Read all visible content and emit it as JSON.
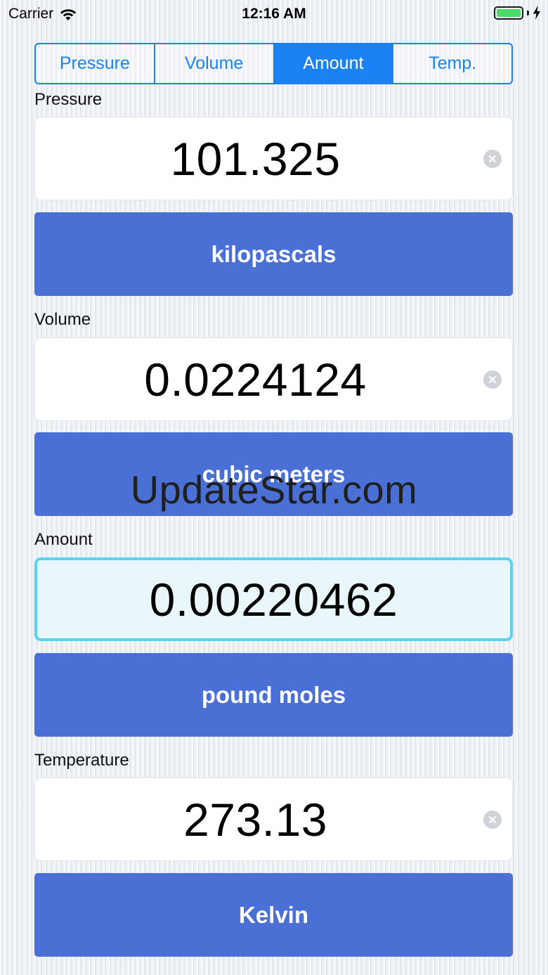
{
  "status_bar": {
    "carrier": "Carrier",
    "time": "12:16 AM",
    "battery_color": "#4cd964"
  },
  "tabs": {
    "items": [
      {
        "label": "Pressure"
      },
      {
        "label": "Volume"
      },
      {
        "label": "Amount"
      },
      {
        "label": "Temp."
      }
    ],
    "selected": "Amount",
    "accent_color": "#1a82f5"
  },
  "fields": {
    "pressure": {
      "label": "Pressure",
      "value": "101.325",
      "unit": "kilopascals"
    },
    "volume": {
      "label": "Volume",
      "value": "0.0224124",
      "unit": "cubic meters"
    },
    "amount": {
      "label": "Amount",
      "value": "0.00220462",
      "unit": "pound moles"
    },
    "temperature": {
      "label": "Temperature",
      "value": "273.13",
      "unit": "Kelvin"
    }
  },
  "unit_button_color": "#4a6fd5",
  "watermark": "UpdateStar.com",
  "icons": {
    "wifi": "wifi-icon",
    "battery": "battery-icon",
    "charging": "charging-bolt-icon",
    "clear": "clear-circle-icon"
  }
}
